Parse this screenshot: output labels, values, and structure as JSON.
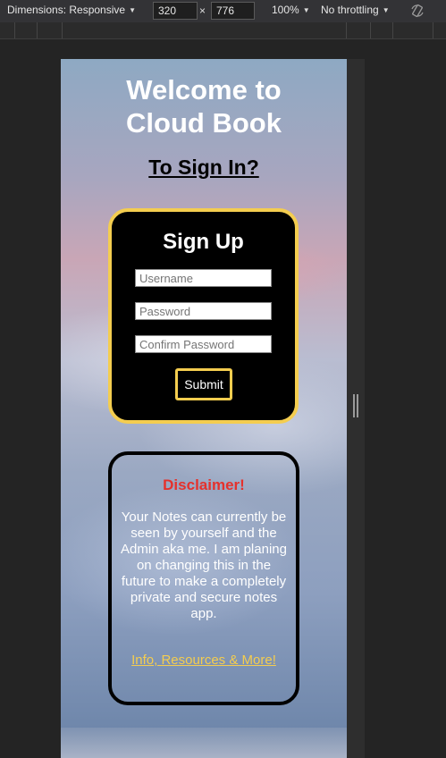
{
  "devtools": {
    "dimensions_label": "Dimensions: Responsive",
    "width_value": "320",
    "times": "×",
    "height_value": "776",
    "zoom": "100%",
    "throttling": "No throttling"
  },
  "page": {
    "title_line1": "Welcome to",
    "title_line2": "Cloud Book",
    "signin_link": "To Sign In?",
    "signup": {
      "title": "Sign Up",
      "username_placeholder": "Username",
      "password_placeholder": "Password",
      "confirm_placeholder": "Confirm Password",
      "submit_label": "Submit"
    },
    "disclaimer": {
      "title": "Disclaimer!",
      "text": "Your Notes can currently be seen by yourself and the Admin aka me. I am planing on changing this in the future to make a completely private and secure notes app.",
      "link": "Info, Resources & More!"
    }
  },
  "colors": {
    "accent": "#f4cd4f",
    "disclaimer_title": "#e5312c",
    "card_bg": "#000000"
  },
  "icons": {
    "rotate": "rotate-icon",
    "dropdown": "chevron-down-icon"
  }
}
